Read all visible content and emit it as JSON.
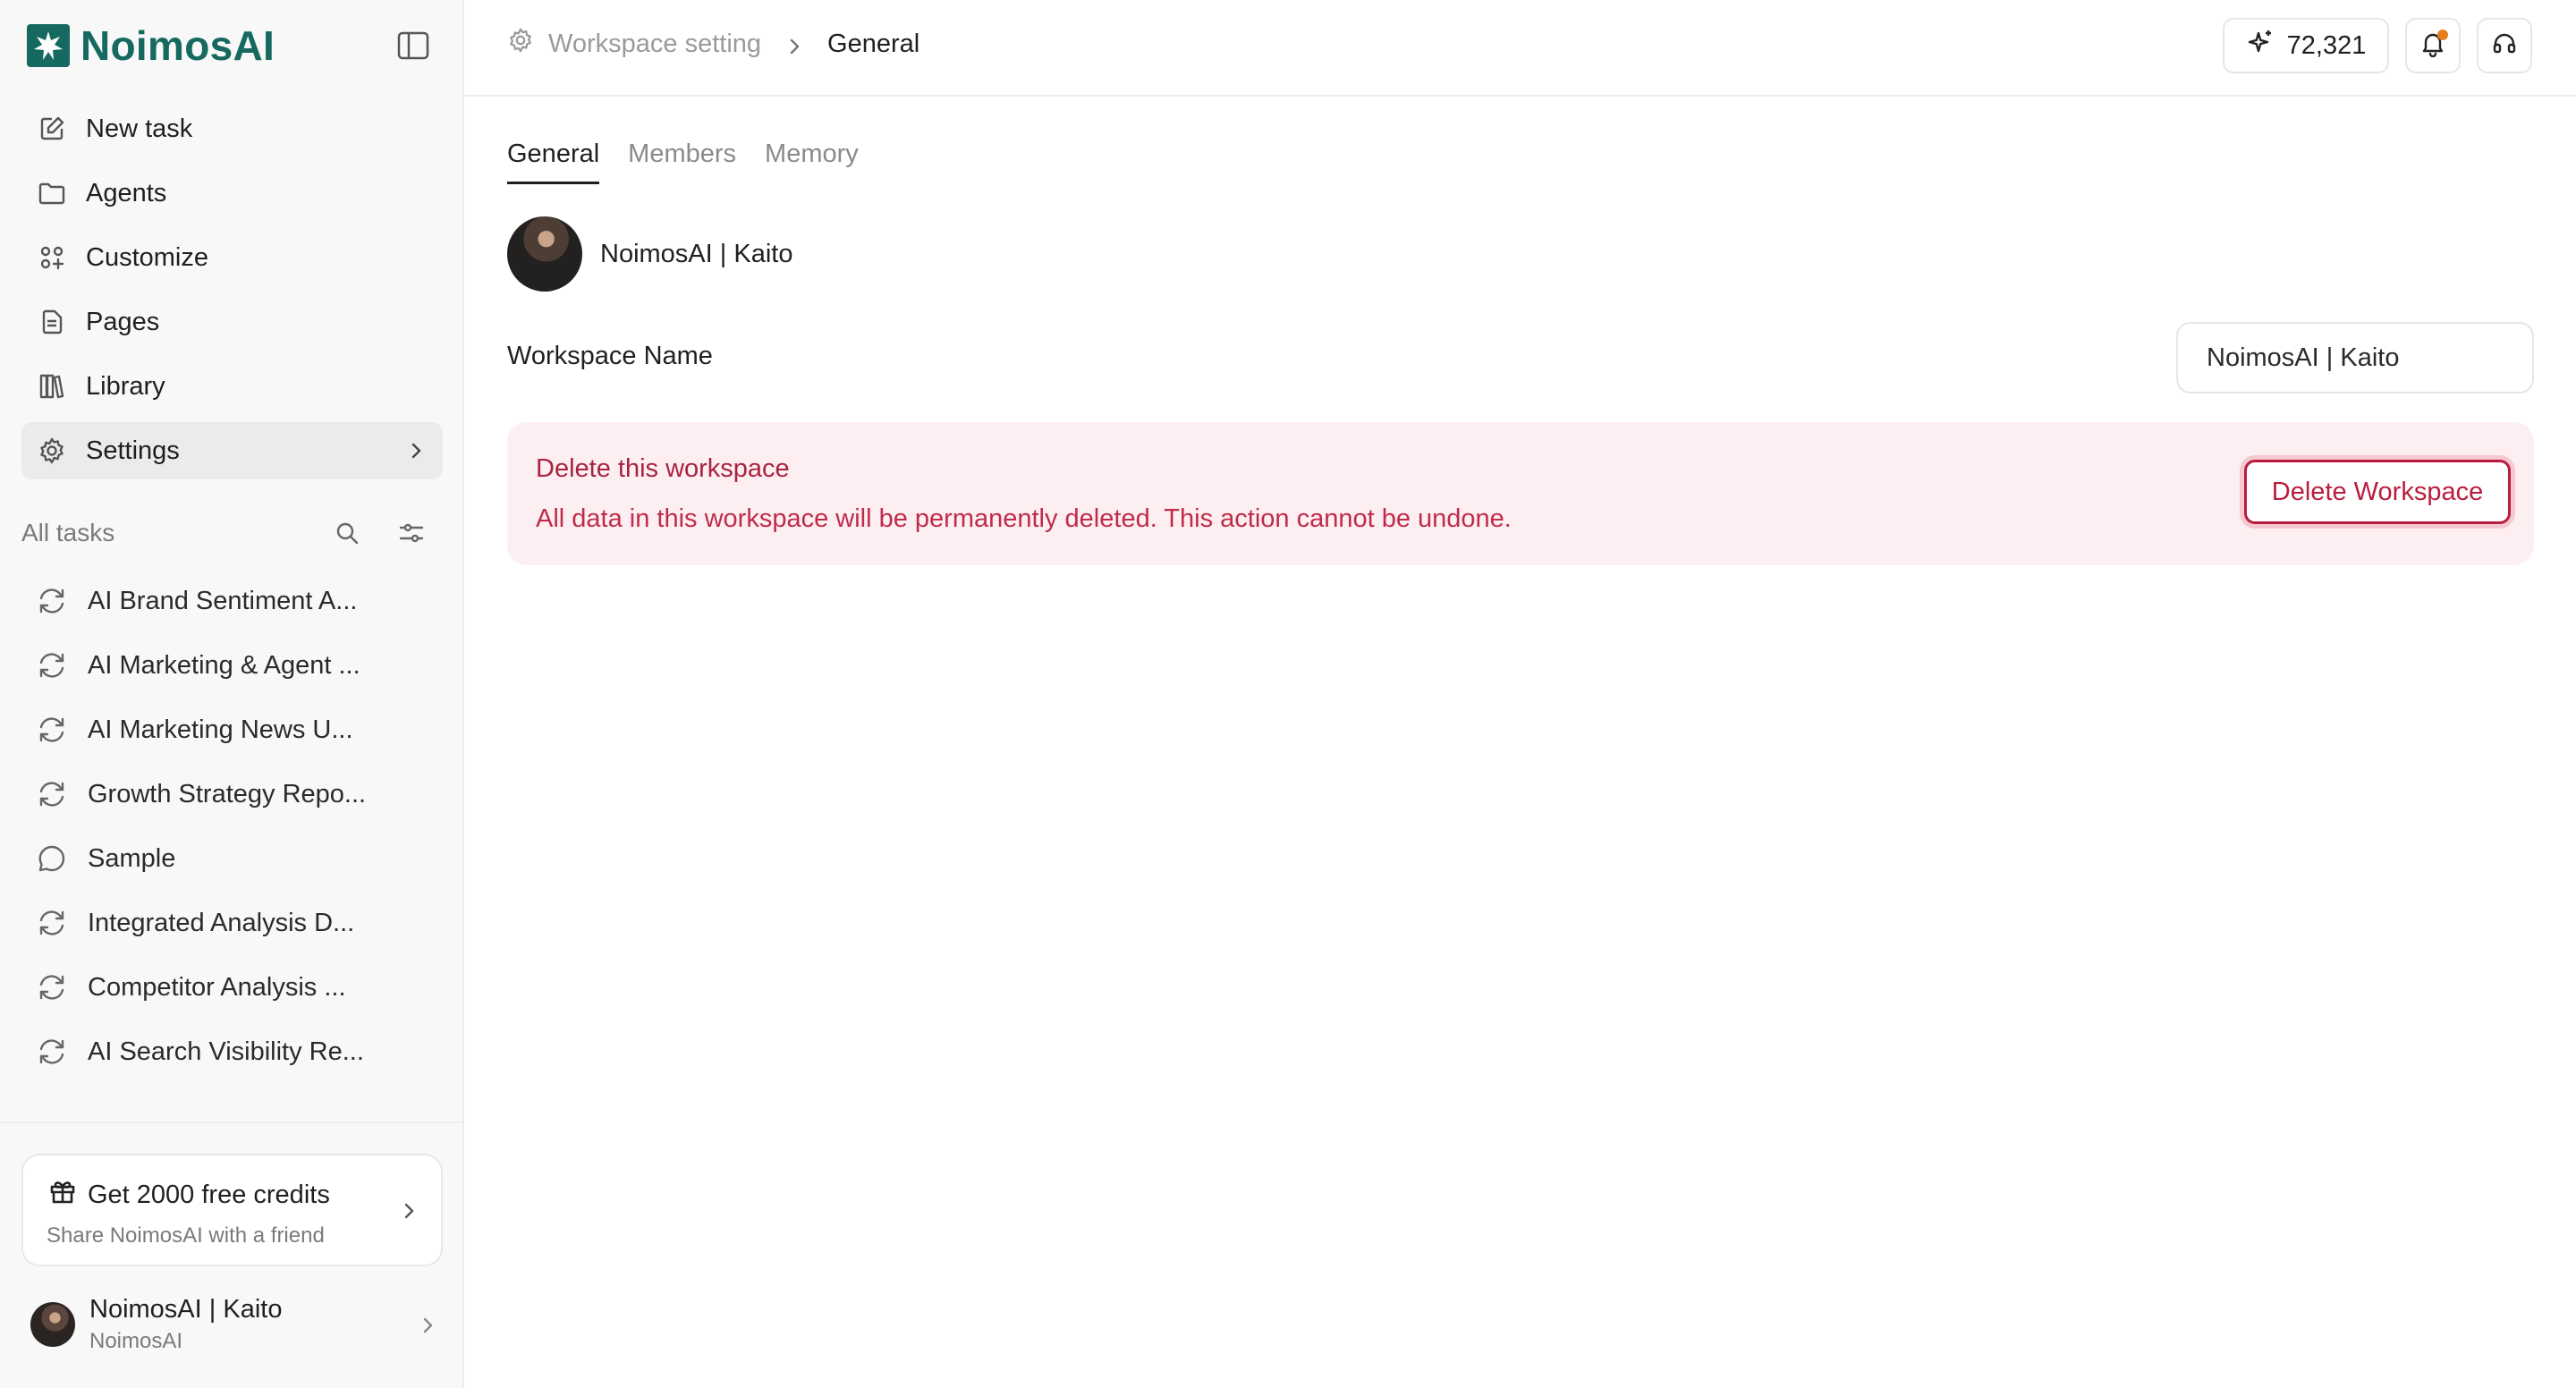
{
  "brand": {
    "name": "NoimosAI",
    "color": "#15695f"
  },
  "nav": [
    {
      "label": "New task",
      "icon": "edit-icon"
    },
    {
      "label": "Agents",
      "icon": "folder-icon"
    },
    {
      "label": "Customize",
      "icon": "grid-plus-icon"
    },
    {
      "label": "Pages",
      "icon": "document-icon"
    },
    {
      "label": "Library",
      "icon": "books-icon"
    },
    {
      "label": "Settings",
      "icon": "gear-icon",
      "active": true
    }
  ],
  "tasks": {
    "title": "All tasks",
    "items": [
      {
        "label": "AI Brand Sentiment A...",
        "icon": "refresh-icon"
      },
      {
        "label": "AI Marketing & Agent ...",
        "icon": "refresh-icon"
      },
      {
        "label": "AI Marketing News U...",
        "icon": "refresh-icon"
      },
      {
        "label": "Growth Strategy Repo...",
        "icon": "refresh-icon"
      },
      {
        "label": "Sample",
        "icon": "chat-bubble-icon"
      },
      {
        "label": "Integrated Analysis D...",
        "icon": "refresh-icon"
      },
      {
        "label": "Competitor Analysis ...",
        "icon": "refresh-icon"
      },
      {
        "label": "AI Search Visibility Re...",
        "icon": "refresh-icon"
      }
    ]
  },
  "promo": {
    "title": "Get 2000 free credits",
    "subtitle": "Share NoimosAI with a friend"
  },
  "user": {
    "name": "NoimosAI | Kaito",
    "org": "NoimosAI"
  },
  "breadcrumb": {
    "parent": "Workspace setting",
    "current": "General"
  },
  "credits": {
    "value": "72,321"
  },
  "notification": {
    "dot_color": "#e87d1e"
  },
  "tabs": [
    {
      "label": "General",
      "active": true
    },
    {
      "label": "Members",
      "active": false
    },
    {
      "label": "Memory",
      "active": false
    }
  ],
  "workspace": {
    "display_name": "NoimosAI | Kaito",
    "name_label": "Workspace Name",
    "name_value": "NoimosAI | Kaito"
  },
  "danger": {
    "title": "Delete this workspace",
    "description": "All data in this workspace will be permanently deleted. This action cannot be undone.",
    "button_label": "Delete Workspace",
    "color": "#b81d3e",
    "background": "#fdeff1"
  }
}
